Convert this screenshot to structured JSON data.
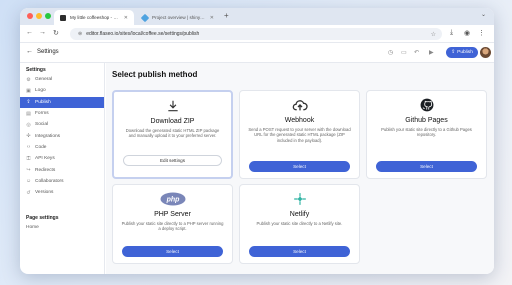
{
  "browser": {
    "tabs": [
      {
        "title": "My little coffeeshop - Pinegrow",
        "favicon_color": "#2d2d2d"
      },
      {
        "title": "Project overview | shiny-pool-",
        "favicon_color": "#4fa3e0"
      }
    ],
    "url": "editor.flaseo.io/sites/local/coffee.se/settings/publish"
  },
  "header": {
    "title": "Settings",
    "publish_label": "Publish"
  },
  "sidebar": {
    "heading": "Settings",
    "items": [
      {
        "label": "General",
        "icon": "gear-icon",
        "glyph": "⚙"
      },
      {
        "label": "Logo",
        "icon": "image-icon",
        "glyph": "▣"
      },
      {
        "label": "Publish",
        "icon": "upload-icon",
        "glyph": "⇪"
      },
      {
        "label": "Forms",
        "icon": "form-icon",
        "glyph": "▤"
      },
      {
        "label": "Social",
        "icon": "share-icon",
        "glyph": "◎"
      },
      {
        "label": "Integrations",
        "icon": "plug-icon",
        "glyph": "✣"
      },
      {
        "label": "Code",
        "icon": "code-icon",
        "glyph": "‹›"
      },
      {
        "label": "API Keys",
        "icon": "key-icon",
        "glyph": "⚿"
      },
      {
        "label": "Redirects",
        "icon": "redirect-icon",
        "glyph": "↪"
      },
      {
        "label": "Collaborators",
        "icon": "users-icon",
        "glyph": "☺"
      },
      {
        "label": "Versions",
        "icon": "history-icon",
        "glyph": "↺"
      }
    ],
    "active_index": 2,
    "page_settings_heading": "Page settings",
    "page_items": [
      {
        "label": "Home"
      }
    ]
  },
  "main": {
    "title": "Select publish method",
    "cards": [
      {
        "title": "Download ZIP",
        "icon": "download-icon",
        "desc": "Download the generated static HTML ZIP package and manually upload it to your preferred server.",
        "button": "Edit settings"
      },
      {
        "title": "Webhook",
        "icon": "cloud-upload-icon",
        "desc": "Send a POST request to your server with the download URL for the generated static HTML package (ZIP included in the payload).",
        "button": "Select"
      },
      {
        "title": "Github Pages",
        "icon": "github-icon",
        "desc": "Publish your static site directly to a Github Pages repository.",
        "button": "Select"
      },
      {
        "title": "PHP Server",
        "icon": "php-icon",
        "desc": "Publish your static site directly to a PHP server running a deploy script.",
        "button": "Select"
      },
      {
        "title": "Netlify",
        "icon": "netlify-icon",
        "desc": "Publish your static site directly to a Netlify site.",
        "button": "Select"
      }
    ]
  },
  "colors": {
    "accent": "#3f63d6",
    "sidebar_active": "#3f63d6"
  }
}
